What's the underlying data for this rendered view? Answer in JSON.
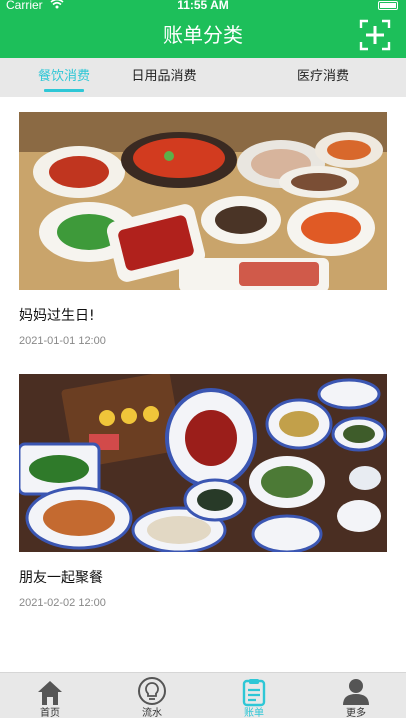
{
  "status_bar": {
    "carrier": "Carrier",
    "time": "11:55 AM"
  },
  "header": {
    "title": "账单分类"
  },
  "tabs": [
    {
      "label": "餐饮消费"
    },
    {
      "label": "日用品消费"
    },
    {
      "label": "医疗消费"
    }
  ],
  "bills": [
    {
      "title": "妈妈过生日!",
      "date": "2021-01-01  12:00"
    },
    {
      "title": "朋友一起聚餐",
      "date": "2021-02-02  12:00"
    }
  ],
  "bottom_nav": [
    {
      "label": "首页",
      "icon": "home-icon"
    },
    {
      "label": "流水",
      "icon": "lightbulb-icon"
    },
    {
      "label": "账单",
      "icon": "bill-icon"
    },
    {
      "label": "更多",
      "icon": "user-icon"
    }
  ],
  "colors": {
    "primary": "#1dbf5a",
    "accent": "#2ec7d6",
    "tab_bg": "#e8e8e8"
  }
}
